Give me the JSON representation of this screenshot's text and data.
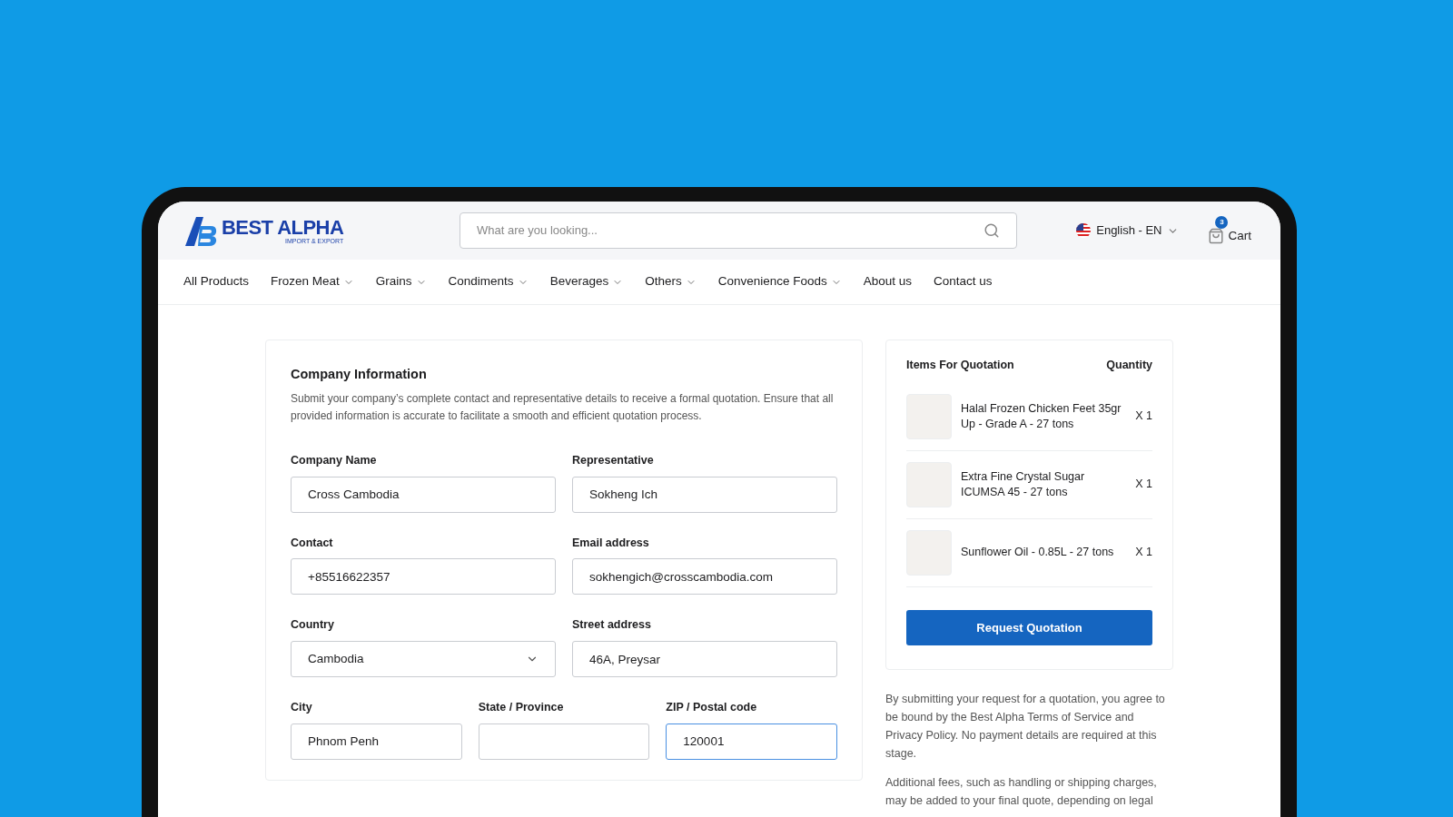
{
  "header": {
    "logo": {
      "name": "BEST ALPHA",
      "tagline": "IMPORT & EXPORT"
    },
    "search": {
      "placeholder": "What are you looking..."
    },
    "language": "English - EN",
    "cart": {
      "label": "Cart",
      "count": "3"
    }
  },
  "nav": [
    {
      "label": "All Products",
      "dropdown": false
    },
    {
      "label": "Frozen Meat",
      "dropdown": true
    },
    {
      "label": "Grains",
      "dropdown": true
    },
    {
      "label": "Condiments",
      "dropdown": true
    },
    {
      "label": "Beverages",
      "dropdown": true
    },
    {
      "label": "Others",
      "dropdown": true
    },
    {
      "label": "Convenience Foods",
      "dropdown": true
    },
    {
      "label": "About us",
      "dropdown": false
    },
    {
      "label": "Contact us",
      "dropdown": false
    }
  ],
  "form": {
    "title": "Company Information",
    "description": "Submit your company’s complete contact and representative details to receive a formal quotation. Ensure that all provided information is accurate to facilitate a smooth and efficient quotation process.",
    "rows": [
      [
        {
          "label": "Company Name",
          "value": "Cross Cambodia",
          "kind": "text",
          "focused": false
        },
        {
          "label": "Representative",
          "value": "Sokheng Ich",
          "kind": "text",
          "focused": false
        }
      ],
      [
        {
          "label": "Contact",
          "value": "+85516622357",
          "kind": "text",
          "focused": false
        },
        {
          "label": "Email address",
          "value": "sokhengich@crosscambodia.com",
          "kind": "text",
          "focused": false
        }
      ],
      [
        {
          "label": "Country",
          "value": "Cambodia",
          "kind": "select",
          "focused": false
        },
        {
          "label": "Street address",
          "value": "46A, Preysar",
          "kind": "text",
          "focused": false
        }
      ],
      [
        {
          "label": "City",
          "value": "Phnom Penh",
          "kind": "text",
          "focused": false
        },
        {
          "label": "State / Province",
          "kind": "text",
          "focused": false
        },
        {
          "label": "ZIP / Postal code",
          "value": "120001",
          "kind": "text",
          "focused": true
        }
      ]
    ]
  },
  "quotation": {
    "heading": "Items For Quotation",
    "quantity_heading": "Quantity",
    "items": [
      {
        "name": "Halal Frozen Chicken Feet 35gr Up - Grade A - 27 tons",
        "quantity": "X 1"
      },
      {
        "name": "Extra Fine Crystal Sugar ICUMSA 45 - 27 tons",
        "quantity": "X 1"
      },
      {
        "name": "Sunflower Oil - 0.85L - 27 tons",
        "quantity": "X 1"
      }
    ],
    "button": "Request Quotation"
  },
  "notes": [
    "By submitting your request for a quotation, you agree to be bound by the Best Alpha Terms of Service and Privacy Policy. No payment details are required at this stage.",
    "Additional fees, such as handling or shipping charges, may be added to your final quote, depending on legal"
  ]
}
